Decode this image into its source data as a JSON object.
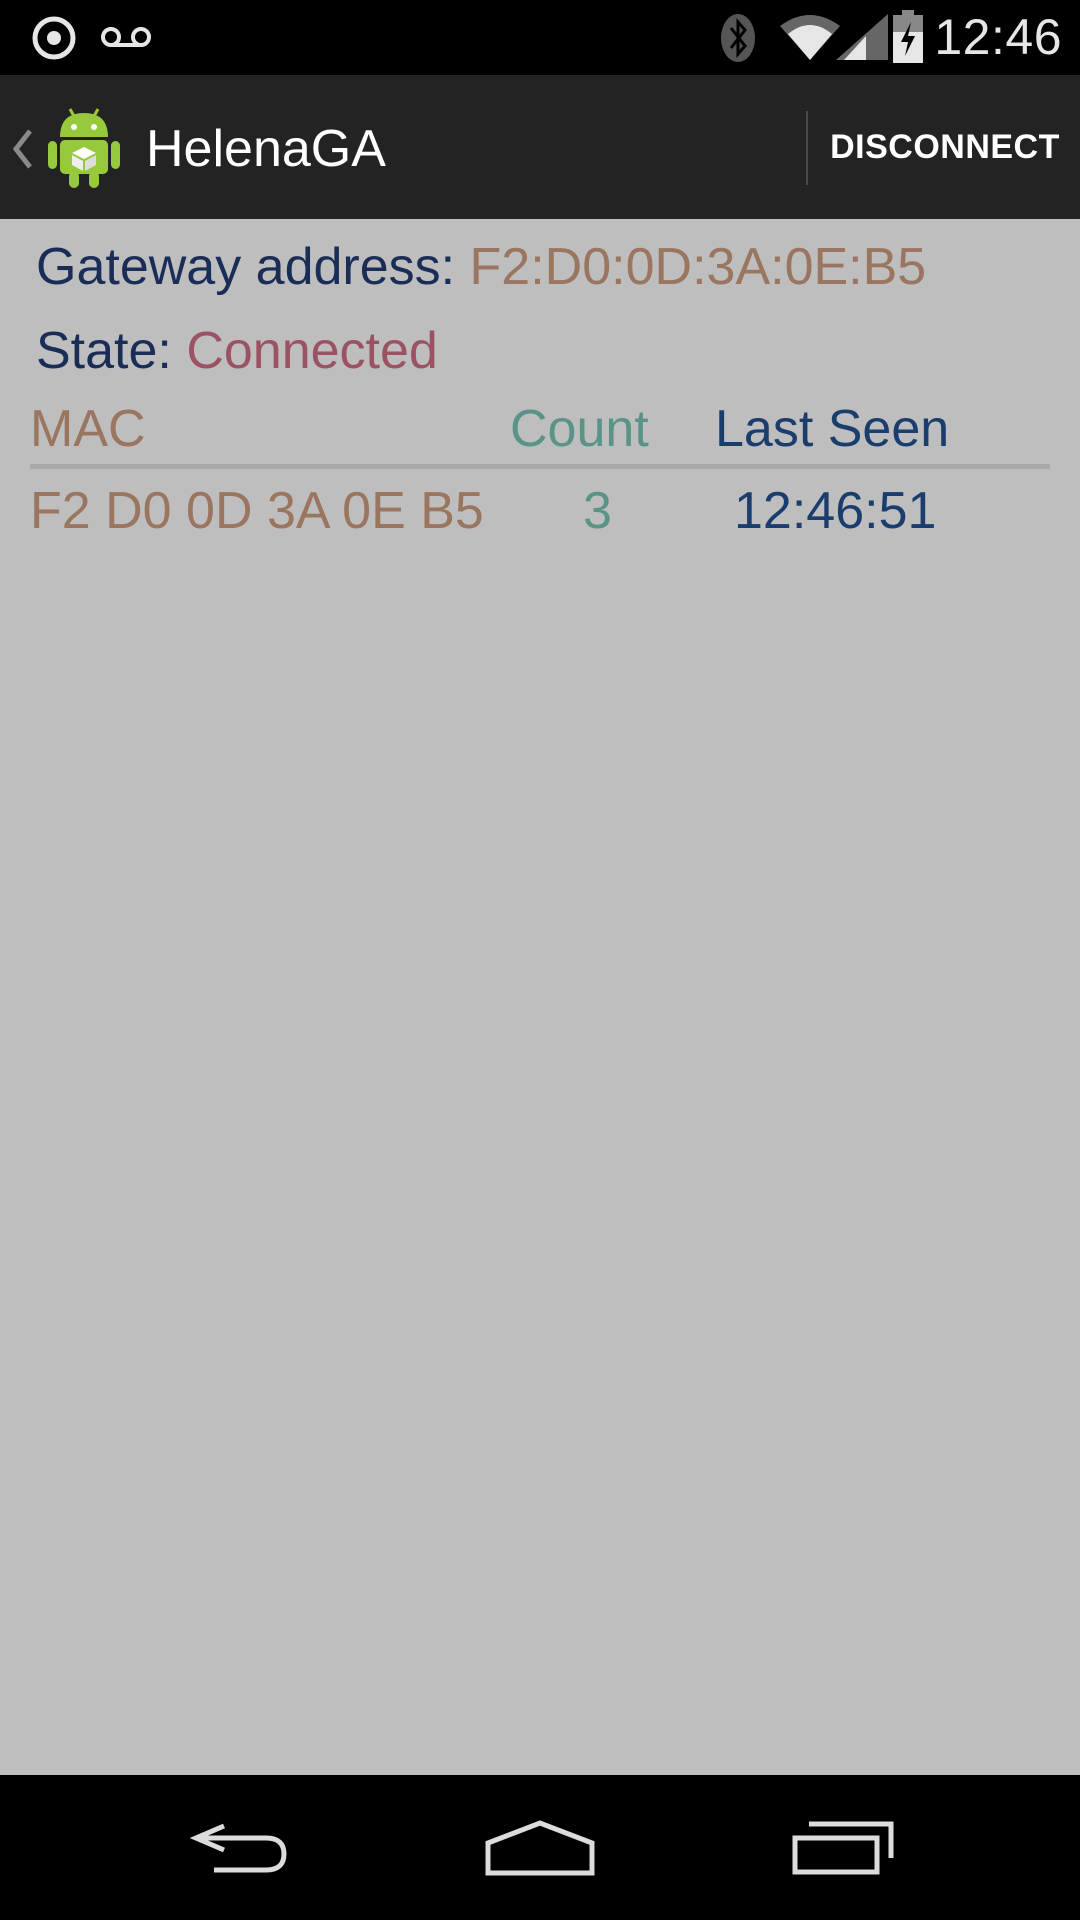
{
  "status_bar": {
    "time": "12:46",
    "icons": [
      "sync-icon",
      "voicemail-icon",
      "bluetooth-icon",
      "wifi-icon",
      "signal-icon",
      "battery-charging-icon"
    ]
  },
  "action_bar": {
    "title": "HelenaGA",
    "action_label": "DISCONNECT",
    "icons": [
      "up-caret-icon",
      "android-logo-icon"
    ]
  },
  "content": {
    "gateway_label": "Gateway address: ",
    "gateway_value": "F2:D0:0D:3A:0E:B5",
    "state_label": "State: ",
    "state_value": "Connected",
    "table": {
      "columns": [
        "MAC",
        "Count",
        "Last Seen"
      ],
      "rows": [
        {
          "mac": "F2 D0 0D 3A 0E B5",
          "count": "3",
          "last_seen": "12:46:51"
        }
      ]
    }
  },
  "nav_bar": {
    "icons": [
      "back-icon",
      "home-icon",
      "recents-icon"
    ]
  },
  "colors": {
    "label": "#1a2d57",
    "mac": "#9a7560",
    "state": "#9b5363",
    "count": "#5a9488",
    "last_seen": "#1a3d6e",
    "content_bg": "#bebebe",
    "action_bar_bg": "#232323"
  }
}
